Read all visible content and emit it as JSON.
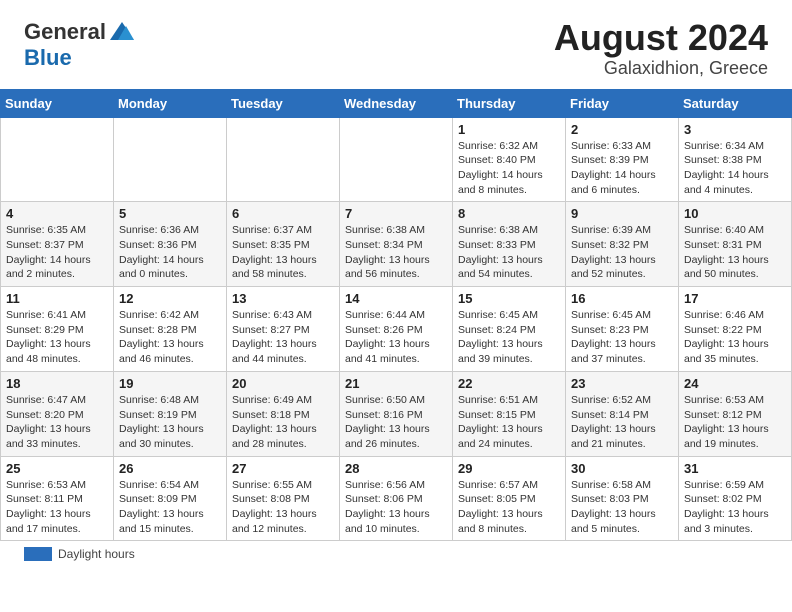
{
  "header": {
    "logo_general": "General",
    "logo_blue": "Blue",
    "month": "August 2024",
    "location": "Galaxidhion, Greece"
  },
  "days_of_week": [
    "Sunday",
    "Monday",
    "Tuesday",
    "Wednesday",
    "Thursday",
    "Friday",
    "Saturday"
  ],
  "legend_label": "Daylight hours",
  "weeks": [
    [
      {
        "day": "",
        "info": ""
      },
      {
        "day": "",
        "info": ""
      },
      {
        "day": "",
        "info": ""
      },
      {
        "day": "",
        "info": ""
      },
      {
        "day": "1",
        "info": "Sunrise: 6:32 AM\nSunset: 8:40 PM\nDaylight: 14 hours\nand 8 minutes."
      },
      {
        "day": "2",
        "info": "Sunrise: 6:33 AM\nSunset: 8:39 PM\nDaylight: 14 hours\nand 6 minutes."
      },
      {
        "day": "3",
        "info": "Sunrise: 6:34 AM\nSunset: 8:38 PM\nDaylight: 14 hours\nand 4 minutes."
      }
    ],
    [
      {
        "day": "4",
        "info": "Sunrise: 6:35 AM\nSunset: 8:37 PM\nDaylight: 14 hours\nand 2 minutes."
      },
      {
        "day": "5",
        "info": "Sunrise: 6:36 AM\nSunset: 8:36 PM\nDaylight: 14 hours\nand 0 minutes."
      },
      {
        "day": "6",
        "info": "Sunrise: 6:37 AM\nSunset: 8:35 PM\nDaylight: 13 hours\nand 58 minutes."
      },
      {
        "day": "7",
        "info": "Sunrise: 6:38 AM\nSunset: 8:34 PM\nDaylight: 13 hours\nand 56 minutes."
      },
      {
        "day": "8",
        "info": "Sunrise: 6:38 AM\nSunset: 8:33 PM\nDaylight: 13 hours\nand 54 minutes."
      },
      {
        "day": "9",
        "info": "Sunrise: 6:39 AM\nSunset: 8:32 PM\nDaylight: 13 hours\nand 52 minutes."
      },
      {
        "day": "10",
        "info": "Sunrise: 6:40 AM\nSunset: 8:31 PM\nDaylight: 13 hours\nand 50 minutes."
      }
    ],
    [
      {
        "day": "11",
        "info": "Sunrise: 6:41 AM\nSunset: 8:29 PM\nDaylight: 13 hours\nand 48 minutes."
      },
      {
        "day": "12",
        "info": "Sunrise: 6:42 AM\nSunset: 8:28 PM\nDaylight: 13 hours\nand 46 minutes."
      },
      {
        "day": "13",
        "info": "Sunrise: 6:43 AM\nSunset: 8:27 PM\nDaylight: 13 hours\nand 44 minutes."
      },
      {
        "day": "14",
        "info": "Sunrise: 6:44 AM\nSunset: 8:26 PM\nDaylight: 13 hours\nand 41 minutes."
      },
      {
        "day": "15",
        "info": "Sunrise: 6:45 AM\nSunset: 8:24 PM\nDaylight: 13 hours\nand 39 minutes."
      },
      {
        "day": "16",
        "info": "Sunrise: 6:45 AM\nSunset: 8:23 PM\nDaylight: 13 hours\nand 37 minutes."
      },
      {
        "day": "17",
        "info": "Sunrise: 6:46 AM\nSunset: 8:22 PM\nDaylight: 13 hours\nand 35 minutes."
      }
    ],
    [
      {
        "day": "18",
        "info": "Sunrise: 6:47 AM\nSunset: 8:20 PM\nDaylight: 13 hours\nand 33 minutes."
      },
      {
        "day": "19",
        "info": "Sunrise: 6:48 AM\nSunset: 8:19 PM\nDaylight: 13 hours\nand 30 minutes."
      },
      {
        "day": "20",
        "info": "Sunrise: 6:49 AM\nSunset: 8:18 PM\nDaylight: 13 hours\nand 28 minutes."
      },
      {
        "day": "21",
        "info": "Sunrise: 6:50 AM\nSunset: 8:16 PM\nDaylight: 13 hours\nand 26 minutes."
      },
      {
        "day": "22",
        "info": "Sunrise: 6:51 AM\nSunset: 8:15 PM\nDaylight: 13 hours\nand 24 minutes."
      },
      {
        "day": "23",
        "info": "Sunrise: 6:52 AM\nSunset: 8:14 PM\nDaylight: 13 hours\nand 21 minutes."
      },
      {
        "day": "24",
        "info": "Sunrise: 6:53 AM\nSunset: 8:12 PM\nDaylight: 13 hours\nand 19 minutes."
      }
    ],
    [
      {
        "day": "25",
        "info": "Sunrise: 6:53 AM\nSunset: 8:11 PM\nDaylight: 13 hours\nand 17 minutes."
      },
      {
        "day": "26",
        "info": "Sunrise: 6:54 AM\nSunset: 8:09 PM\nDaylight: 13 hours\nand 15 minutes."
      },
      {
        "day": "27",
        "info": "Sunrise: 6:55 AM\nSunset: 8:08 PM\nDaylight: 13 hours\nand 12 minutes."
      },
      {
        "day": "28",
        "info": "Sunrise: 6:56 AM\nSunset: 8:06 PM\nDaylight: 13 hours\nand 10 minutes."
      },
      {
        "day": "29",
        "info": "Sunrise: 6:57 AM\nSunset: 8:05 PM\nDaylight: 13 hours\nand 8 minutes."
      },
      {
        "day": "30",
        "info": "Sunrise: 6:58 AM\nSunset: 8:03 PM\nDaylight: 13 hours\nand 5 minutes."
      },
      {
        "day": "31",
        "info": "Sunrise: 6:59 AM\nSunset: 8:02 PM\nDaylight: 13 hours\nand 3 minutes."
      }
    ]
  ]
}
